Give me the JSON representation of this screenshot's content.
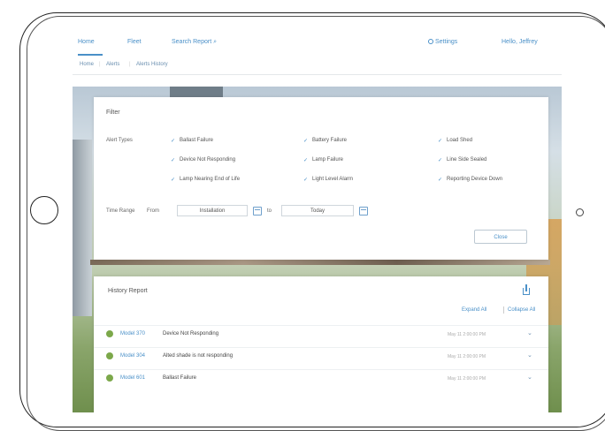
{
  "nav": {
    "home": "Home",
    "fleet": "Fleet",
    "search": "Search Report ⌕",
    "settings": "Settings",
    "user": "Hello, Jeffrey"
  },
  "breadcrumb": [
    "Home",
    "Alerts",
    "Alerts History"
  ],
  "filter": {
    "title": "Filter",
    "alert_types_label": "Alert Types",
    "options": [
      [
        "Ballast Failure",
        "Battery Failure",
        "Load Shed"
      ],
      [
        "Device Not Responding",
        "Lamp Failure",
        "Line Side Sealed"
      ],
      [
        "Lamp Nearing End of Life",
        "Light Level Alarm",
        "Reporting Device Down"
      ]
    ],
    "time_range_label": "Time Range",
    "from_label": "From",
    "from_value": "Installation",
    "to_label": "to",
    "to_value": "Today",
    "close_label": "Close"
  },
  "history": {
    "title": "History Report",
    "expand_all": "Expand All",
    "collapse_all": "Collapse All",
    "rows": [
      {
        "device": "Model 370",
        "message": "Device Not Responding",
        "time": "May 11 2:00:00 PM"
      },
      {
        "device": "Model 304",
        "message": "Alted shade is not responding",
        "time": "May 11 2:00:00 PM"
      },
      {
        "device": "Model 601",
        "message": "Ballast Failure",
        "time": "May 11 2:00:00 PM"
      }
    ]
  },
  "colors": {
    "accent": "#4a90c8",
    "status_ok": "#7ca84a"
  }
}
